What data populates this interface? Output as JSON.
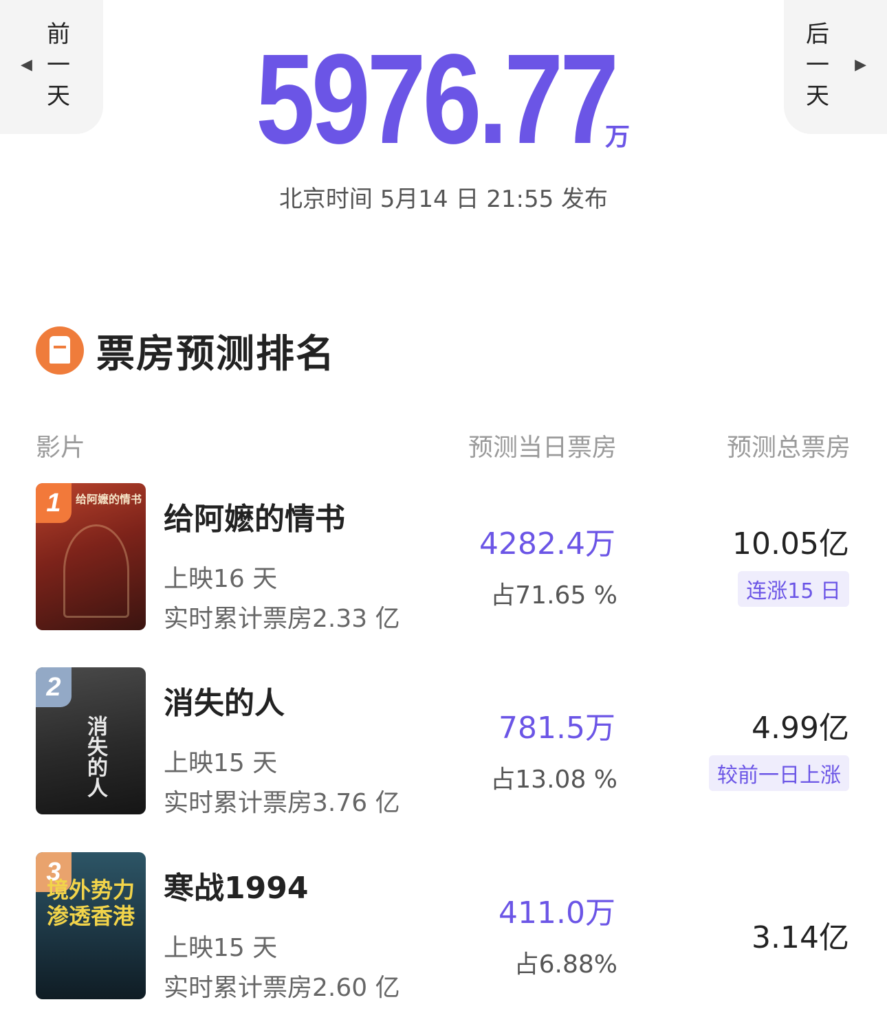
{
  "header": {
    "prev_day": [
      "前",
      "一",
      "天"
    ],
    "next_day": [
      "后",
      "一",
      "天"
    ],
    "prev_arrow": "◀",
    "next_arrow": "▶",
    "total": "5976.77",
    "total_unit": "万",
    "publish_time": "北京时间 5月14 日 21:55 发布",
    "accent_color": "#6b55e6"
  },
  "ranking": {
    "title": "票房预测排名",
    "icon": "box-office-icon",
    "columns": {
      "film": "影片",
      "today": "预测当日票房",
      "total": "预测总票房"
    }
  },
  "movies": [
    {
      "rank": "1",
      "title": "给阿嬷的情书",
      "days": "上映16 天",
      "cumulative": "实时累计票房2.33 亿",
      "today": "4282.4万",
      "share": "占71.65 %",
      "total": "10.05亿",
      "tag": "连涨15 日",
      "poster_text": "给阿嬷的情书",
      "poster_color": "#8a2a1e",
      "badge_color": "#f2793a"
    },
    {
      "rank": "2",
      "title": "消失的人",
      "days": "上映15 天",
      "cumulative": "实时累计票房3.76 亿",
      "today": "781.5万",
      "share": "占13.08 %",
      "total": "4.99亿",
      "tag": "较前一日上涨",
      "poster_text": "消失的人",
      "poster_color": "#3a3a3a",
      "badge_color": "#93a9c6"
    },
    {
      "rank": "3",
      "title": "寒战1994",
      "days": "上映15 天",
      "cumulative": "实时累计票房2.60 亿",
      "today": "411.0万",
      "share": "占6.88%",
      "total": "3.14亿",
      "tag": "",
      "poster_text": "境外势力渗透香港",
      "poster_color": "#1f3b48",
      "badge_color": "#e9a36d"
    }
  ]
}
